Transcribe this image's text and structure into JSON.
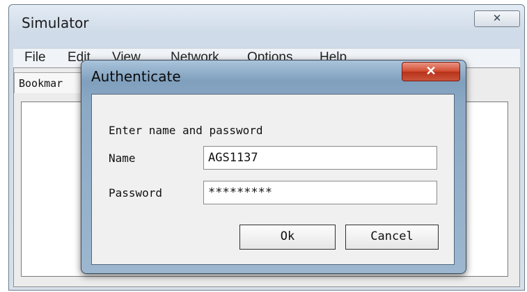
{
  "main_window": {
    "title": "Simulator",
    "close_glyph": "✕",
    "menu": [
      "File",
      "Edit",
      "View",
      "Network",
      "Options",
      "Help"
    ],
    "tab_label": "Bookmar"
  },
  "dialog": {
    "title": "Authenticate",
    "close_glyph": "✕",
    "prompt": "Enter name and password",
    "name_label": "Name",
    "name_value": "AGS1137",
    "password_label": "Password",
    "password_value": "*********",
    "ok_label": "Ok",
    "cancel_label": "Cancel"
  }
}
